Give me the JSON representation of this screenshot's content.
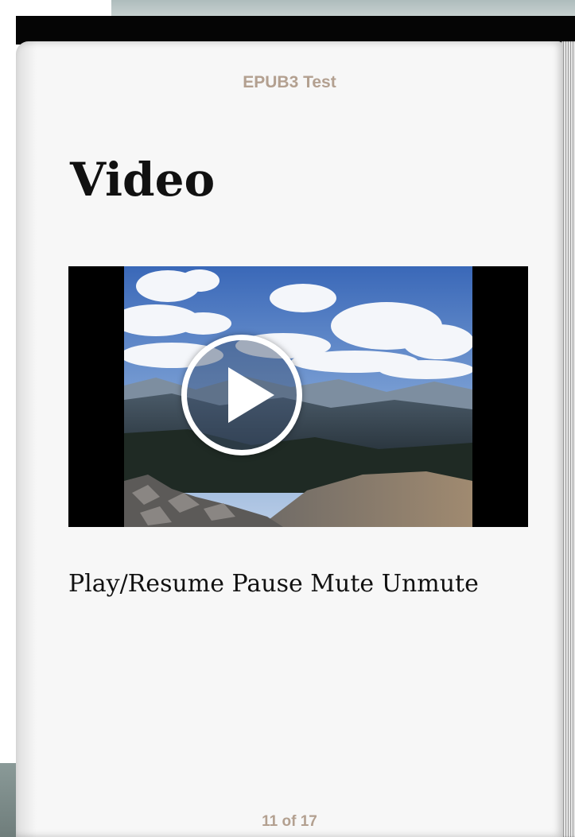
{
  "book": {
    "running_head": "EPUB3 Test",
    "chapter_title": "Video",
    "page_indicator": "11 of 17"
  },
  "video": {
    "play_overlay_icon": "play-circle-icon",
    "poster_subject": "mountain-summit-landscape"
  },
  "controls": {
    "play_resume": "Play/Resume",
    "pause": "Pause",
    "mute": "Mute",
    "unmute": "Unmute"
  },
  "colors": {
    "running_head": "#b3a090",
    "page_background": "#f7f7f7",
    "top_bar": "#050505"
  }
}
